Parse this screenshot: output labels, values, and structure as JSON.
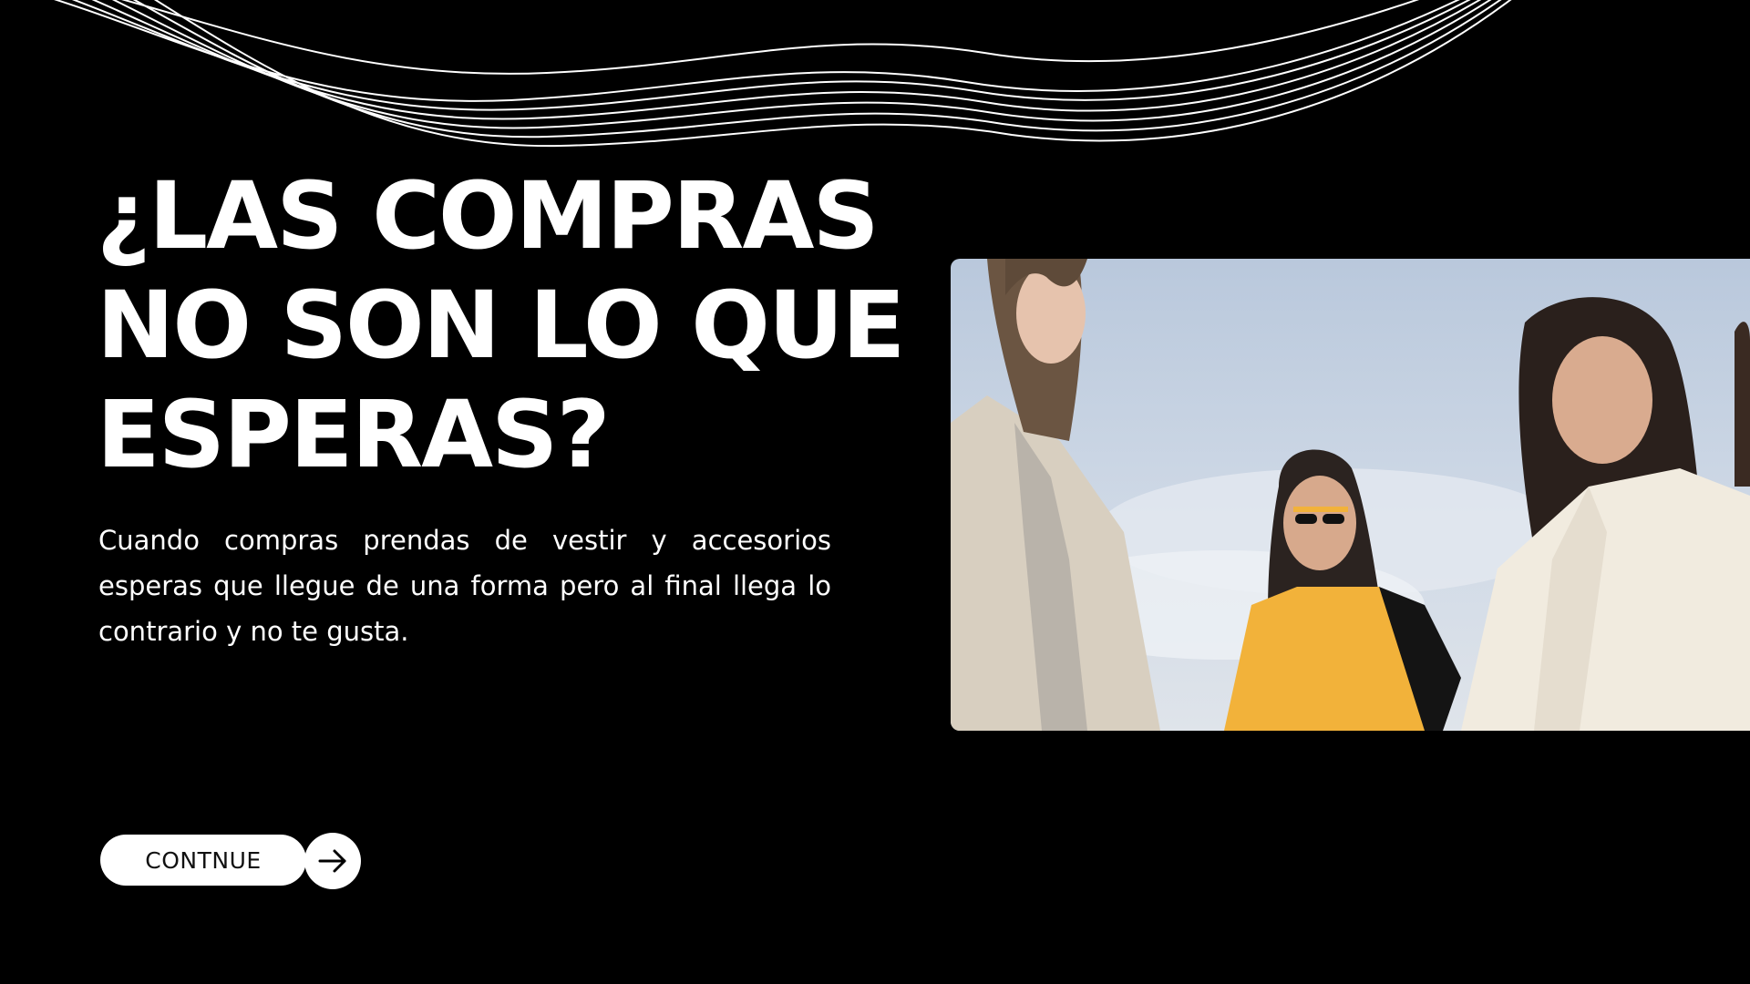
{
  "headline": {
    "line1": "¿LAS COMPRAS",
    "line2": "NO SON LO QUE",
    "line3": "ESPERAS?"
  },
  "body": {
    "text": "Cuando compras prendas de vestir y accesorios esperas que llegue de una forma pero al final llega lo contrario y no te gusta."
  },
  "cta": {
    "label": "CONTNUE",
    "icon": "arrow-right-icon"
  },
  "decoration": {
    "icon": "wavy-lines-graphic"
  },
  "photo": {
    "icon": "fashion-photo"
  },
  "colors": {
    "background": "#000000",
    "text": "#ffffff",
    "accent_yellow": "#f2b23a"
  }
}
